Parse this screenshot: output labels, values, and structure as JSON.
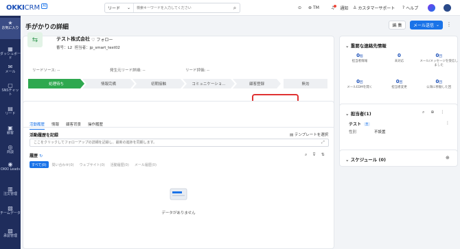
{
  "topbar": {
    "logo_bold": "OKKI",
    "logo_light": "CRM",
    "logo_tag": "AI",
    "search_scope": "リード",
    "search_placeholder": "検索キーワードを入力してください",
    "team_label": "TM",
    "notify_label": "通知",
    "support_label": "カスタマーサポート",
    "help_label": "ヘルプ"
  },
  "sidebar": {
    "items": [
      {
        "label": "お気に入り",
        "icon": "star-icon"
      },
      {
        "label": "ダッシュボード",
        "icon": "chart-icon"
      },
      {
        "label": "メール",
        "icon": "mail-icon"
      },
      {
        "label": "SNSチャット",
        "icon": "chat-icon"
      },
      {
        "label": "リード",
        "icon": "lead-icon"
      },
      {
        "label": "顧客",
        "icon": "customer-icon"
      },
      {
        "label": "商談",
        "icon": "deal-icon"
      },
      {
        "label": "OKKI Leads",
        "icon": "leads-icon"
      },
      {
        "label": "注文管理",
        "icon": "order-icon"
      },
      {
        "label": "チームデータ",
        "icon": "team-data-icon"
      },
      {
        "label": "承認管理",
        "icon": "approval-icon"
      }
    ]
  },
  "page": {
    "title": "手がかりの詳細",
    "edit_label": "編 集",
    "mail_label": "メール送信"
  },
  "lead": {
    "company": "テスト株式会社",
    "follow": "フォロー",
    "number_label": "番号：",
    "number": "L2",
    "owner_label": "担当者：",
    "owner": "jp_smart_test02",
    "fields": [
      {
        "label": "リードソース:",
        "value": "--"
      },
      {
        "label": "発生元リード詳細:",
        "value": "--"
      },
      {
        "label": "リード評価:",
        "value": "--"
      }
    ],
    "stages": [
      "処理待ち",
      "情報完備",
      "初期接触",
      "コミュニケーショ...",
      "顧客登録",
      "無効"
    ]
  },
  "activity": {
    "tabs": [
      "活動履歴",
      "情報",
      "顧客背景",
      "操作履歴"
    ],
    "record_title": "活動履歴を記録",
    "template_label": "テンプレートを選択",
    "note_placeholder": "ここをクリックしてフォローアップの詳細を記録し、最新の進捗を同期します。",
    "history_title": "履歴",
    "filters": [
      "すべて(0)",
      "問い合わせ(0)",
      "ウェブサイト(0)",
      "活動履歴(0)",
      "メール履歴(0)"
    ],
    "empty_text": "データがありません"
  },
  "contact_info": {
    "title": "重要な連絡先情報",
    "stats": [
      {
        "value": "0",
        "unit": "個",
        "label": "担当者情報"
      },
      {
        "value": "0",
        "unit": "",
        "label": "未対応"
      },
      {
        "value": "0",
        "unit": "回",
        "label": "メール/メッセージを受信しました"
      },
      {
        "value": "0",
        "unit": "回",
        "label": "メールEDMを開く"
      },
      {
        "value": "0",
        "unit": "回",
        "label": "担当者変更"
      },
      {
        "value": "0",
        "unit": "回",
        "label": "公海に移動した回"
      }
    ]
  },
  "contacts": {
    "title": "担当者(1)",
    "name": "テスト",
    "badge": "主",
    "gender_label": "性別",
    "gender_value": "不設置"
  },
  "schedule": {
    "title": "スケジュール (0)"
  }
}
